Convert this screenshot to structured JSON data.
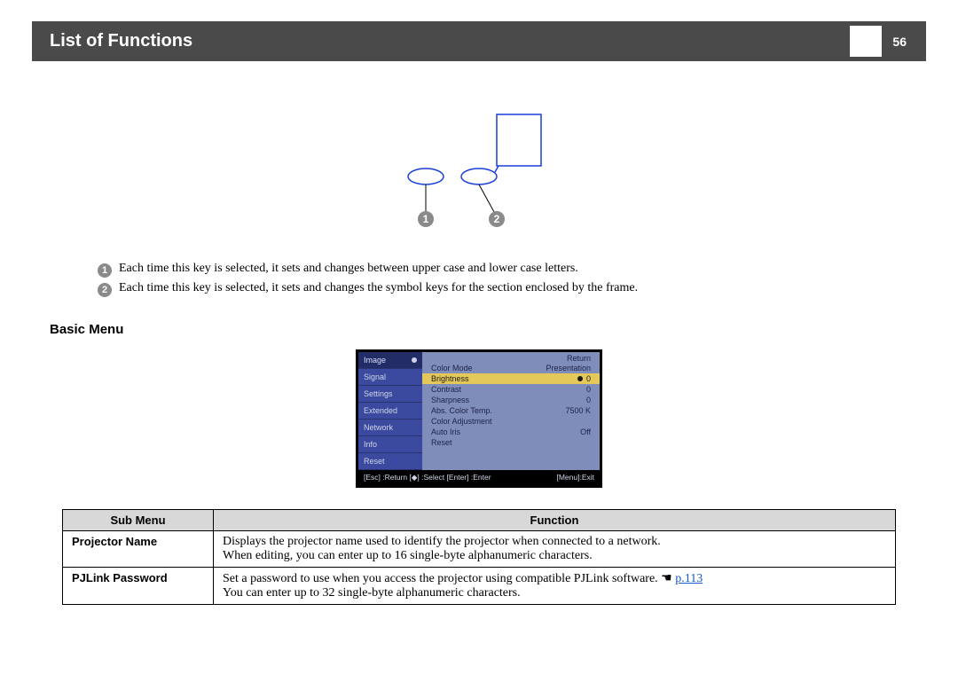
{
  "header": {
    "title": "List of Functions",
    "page": "56"
  },
  "notes": {
    "n1": "Each time this key is selected, it sets and changes between upper case and lower case letters.",
    "n2": "Each time this key is selected, it sets and changes the symbol keys for the section enclosed by the frame."
  },
  "section": {
    "basic_menu": "Basic  Menu"
  },
  "menu": {
    "left": [
      "Image",
      "Signal",
      "Settings",
      "Extended",
      "Network",
      "Info",
      "Reset"
    ],
    "return": "Return",
    "rows": [
      {
        "l": "Color Mode",
        "v": "Presentation"
      },
      {
        "l": "Brightness",
        "v": "0"
      },
      {
        "l": "Contrast",
        "v": "0"
      },
      {
        "l": "Sharpness",
        "v": "0"
      },
      {
        "l": "Abs. Color Temp.",
        "v": "7500 K"
      },
      {
        "l": "Color Adjustment",
        "v": ""
      },
      {
        "l": "Auto Iris",
        "v": "Off"
      },
      {
        "l": "Reset",
        "v": ""
      }
    ],
    "bottom_left": "[Esc] :Return  [◆] :Select  [Enter] :Enter",
    "bottom_right": "[Menu]:Exit"
  },
  "table": {
    "h1": "Sub Menu",
    "h2": "Function",
    "rows": [
      {
        "sub": "Projector Name",
        "line1": "Displays the projector name used to identify the projector when connected to a network.",
        "line2": "When editing, you can enter up to 16 single-byte alphanumeric characters."
      },
      {
        "sub": "PJLink Password",
        "line1_a": "Set a password to use when you access the projector using compatible PJLink software. ",
        "line1_link": "p.113",
        "line2": "You can enter up to 32 single-byte alphanumeric characters."
      }
    ]
  }
}
